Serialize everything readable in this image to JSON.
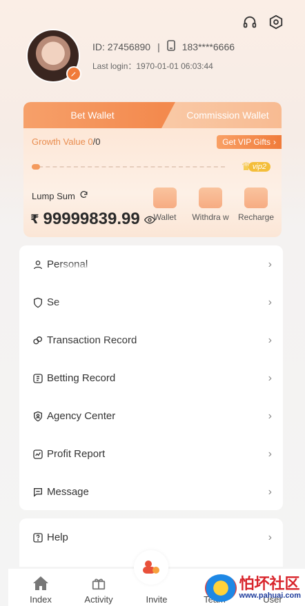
{
  "header": {
    "icons": [
      "headset-icon",
      "settings-hexagon-icon"
    ]
  },
  "profile": {
    "id_label": "ID: 27456890",
    "separator": "|",
    "phone": "183****6666",
    "last_login": "Last login：1970-01-01 06:03:44"
  },
  "wallet": {
    "tabs": [
      {
        "label": "Bet Wallet",
        "active": true
      },
      {
        "label": "Commission Wallet",
        "active": false
      }
    ],
    "growth_label": "Growth Value ",
    "growth_current": "0",
    "growth_sep": "/",
    "growth_target": "0",
    "growth_progress": 0.03,
    "vip_gifts_label": "Get VIP Gifts",
    "vip_badge": "vip2",
    "lump_sum_label": "Lump Sum",
    "currency": "₹",
    "balance": "99999839.99",
    "actions": [
      {
        "label": "Wallet",
        "icon": "wallet-icon"
      },
      {
        "label": "Withdra w",
        "icon": "withdraw-icon"
      },
      {
        "label": "Recharge",
        "icon": "recharge-icon"
      }
    ]
  },
  "menu": {
    "items": [
      {
        "label": "Personal",
        "icon": "person-icon"
      },
      {
        "label": "Se",
        "icon": "shield-icon"
      },
      {
        "label": "Transaction Record",
        "icon": "transaction-icon"
      },
      {
        "label": "Betting Record",
        "icon": "betting-icon"
      },
      {
        "label": "Agency Center",
        "icon": "agency-icon"
      },
      {
        "label": "Profit Report",
        "icon": "chart-icon"
      },
      {
        "label": "Message",
        "icon": "message-icon"
      }
    ],
    "help": {
      "label": "Help",
      "icon": "help-icon"
    }
  },
  "bottom_nav": {
    "items": [
      {
        "label": "Index",
        "icon": "home-icon"
      },
      {
        "label": "Activity",
        "icon": "gift-icon"
      },
      {
        "label": "Invite",
        "icon": "invite-icon"
      },
      {
        "label": "Team",
        "icon": "team-icon"
      },
      {
        "label": "User",
        "icon": "user-icon"
      }
    ]
  },
  "watermark": {
    "title": "怕坏社区",
    "subtitle": "www.pahuai.com"
  },
  "colors": {
    "accent": "#f38a4e",
    "accent_light": "#f8bb92",
    "growth_text": "#e98d4f",
    "vip_gold": "#f4be3a"
  }
}
